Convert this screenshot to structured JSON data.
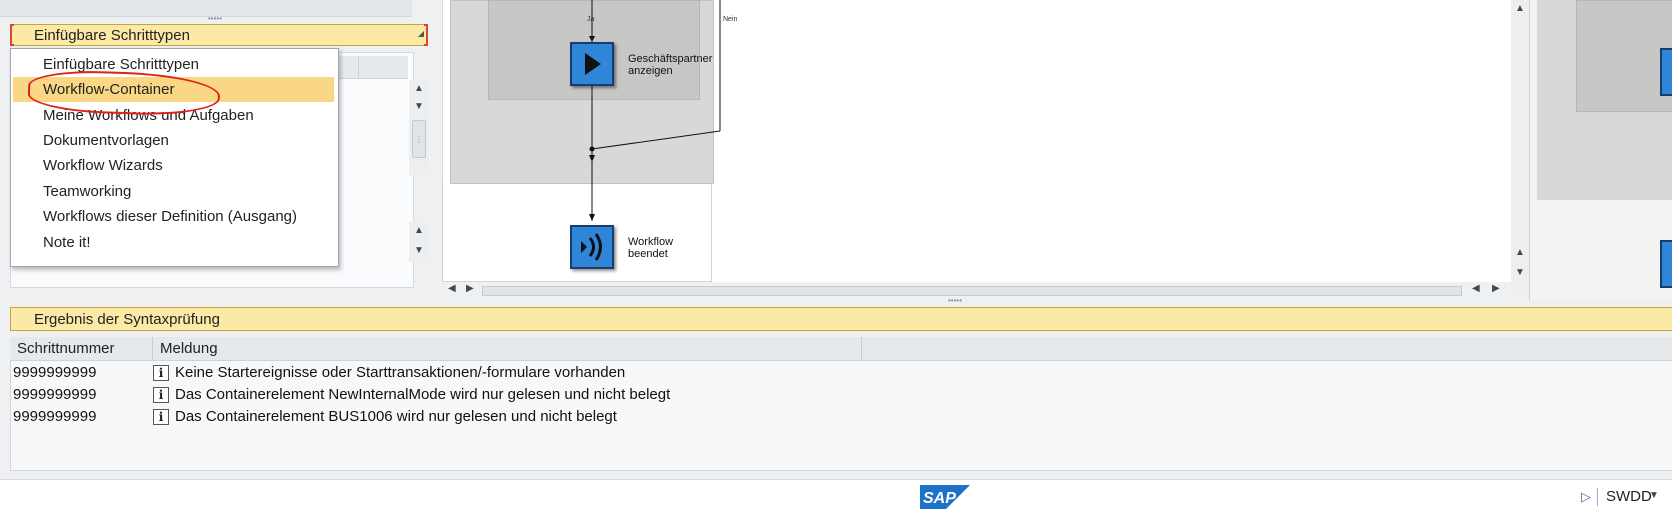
{
  "left_panel": {
    "dropdown": {
      "selected_label": "Einfügbare Schritttypen",
      "options": [
        {
          "label": "Einfügbare Schritttypen"
        },
        {
          "label": "Workflow-Container"
        },
        {
          "label": "Meine Workflows und Aufgaben"
        },
        {
          "label": "Dokumentvorlagen"
        },
        {
          "label": "Workflow Wizards"
        },
        {
          "label": "Teamworking"
        },
        {
          "label": "Workflows dieser Definition (Ausgang)"
        },
        {
          "label": "Note it!"
        }
      ],
      "highlighted_option": "Workflow-Container"
    }
  },
  "workflow_canvas": {
    "branch_labels": {
      "yes": "Ja",
      "no": "Nein"
    },
    "nodes": [
      {
        "label_line1": "Geschäftspartner",
        "label_line2": "anzeigen",
        "icon": "play-step-icon"
      },
      {
        "label_line1": "Workflow",
        "label_line2": "beendet",
        "icon": "workflow-end-icon"
      }
    ]
  },
  "result": {
    "title": "Ergebnis der Syntaxprüfung",
    "columns": [
      "Schrittnummer",
      "Meldung"
    ],
    "rows": [
      {
        "step": "9999999999",
        "icon": "info-icon",
        "message": "Keine Startereignisse oder Starttransaktionen/-formulare vorhanden"
      },
      {
        "step": "9999999999",
        "icon": "info-icon",
        "message": "Das Containerelement NewInternalMode wird nur gelesen und nicht belegt"
      },
      {
        "step": "9999999999",
        "icon": "info-icon",
        "message": "Das Containerelement BUS1006 wird nur gelesen und nicht belegt"
      }
    ]
  },
  "status_bar": {
    "logo_text": "SAP",
    "transaction": "SWDD"
  },
  "colors": {
    "header_yellow": "#fbe9a6",
    "selected_option": "#fad784",
    "annotation_red": "#e0201a",
    "node_blue": "#2f86d9",
    "sap_blue": "#1a73c9"
  }
}
